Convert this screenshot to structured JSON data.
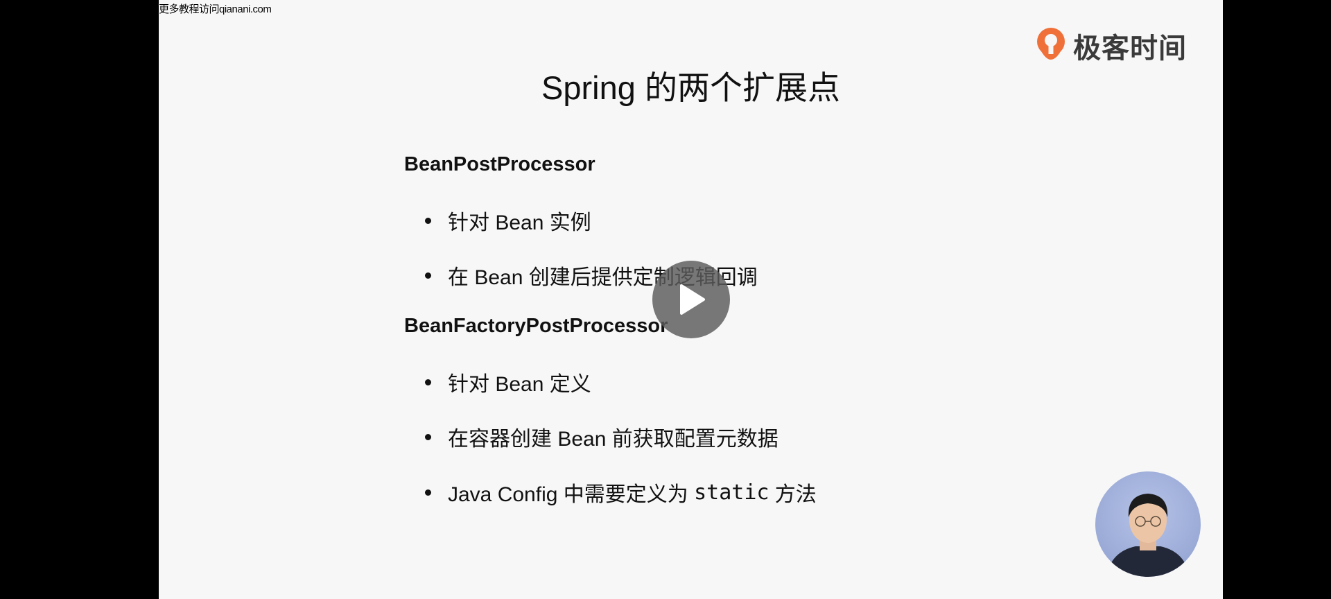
{
  "watermark": {
    "text": "更多教程访问qianani.com"
  },
  "logo": {
    "text": "极客时间",
    "accent_color": "#f0703a"
  },
  "slide": {
    "title": "Spring 的两个扩展点",
    "sections": [
      {
        "heading": "BeanPostProcessor",
        "bullets": [
          {
            "text": "针对 Bean 实例"
          },
          {
            "text": "在 Bean 创建后提供定制逻辑回调"
          }
        ]
      },
      {
        "heading": "BeanFactoryPostProcessor",
        "bullets": [
          {
            "text": "针对 Bean 定义"
          },
          {
            "text": "在容器创建 Bean 前获取配置元数据"
          },
          {
            "text_before": "Java Config 中需要定义为 ",
            "code": "static",
            "text_after": " 方法"
          }
        ]
      }
    ]
  },
  "player": {
    "play_icon": "play-icon"
  },
  "presenter": {
    "avatar_icon": "presenter-avatar"
  }
}
